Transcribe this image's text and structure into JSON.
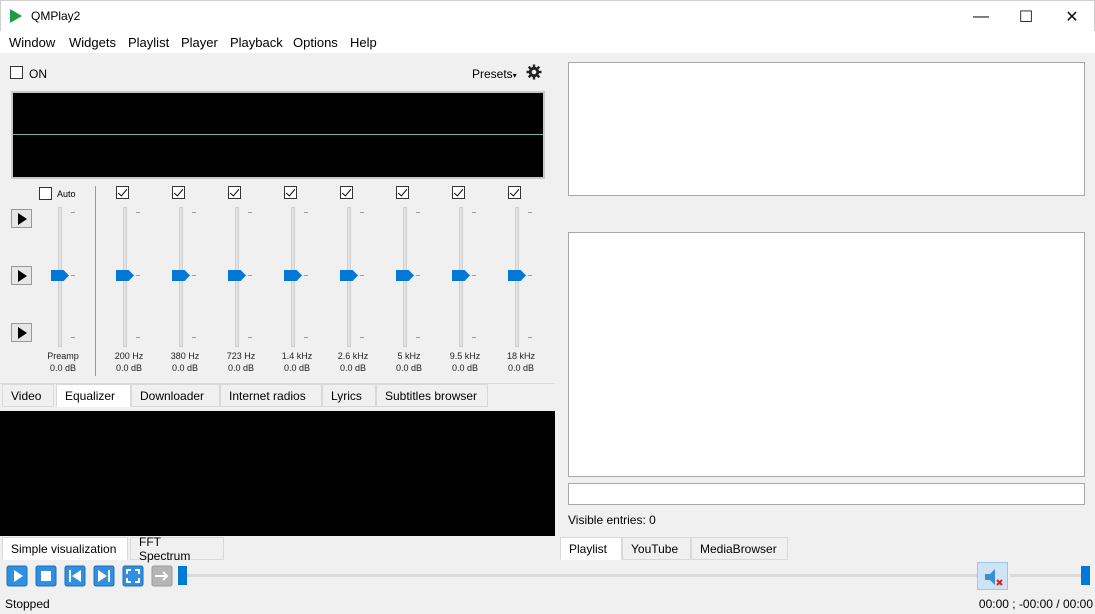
{
  "window": {
    "title": "QMPlay2",
    "minimize": "—",
    "maximize": "☐",
    "close": "✕"
  },
  "menu": [
    "Window",
    "Widgets",
    "Playlist",
    "Player",
    "Playback",
    "Options",
    "Help"
  ],
  "equalizer": {
    "on_label": "ON",
    "on_checked": false,
    "presets_label": "Presets",
    "auto_label": "Auto",
    "auto_checked": false,
    "bands": [
      {
        "label": "Preamp",
        "value": "0.0 dB",
        "checked": null
      },
      {
        "label": "200 Hz",
        "value": "0.0 dB",
        "checked": true
      },
      {
        "label": "380 Hz",
        "value": "0.0 dB",
        "checked": true
      },
      {
        "label": "723 Hz",
        "value": "0.0 dB",
        "checked": true
      },
      {
        "label": "1.4 kHz",
        "value": "0.0 dB",
        "checked": true
      },
      {
        "label": "2.6 kHz",
        "value": "0.0 dB",
        "checked": true
      },
      {
        "label": "5 kHz",
        "value": "0.0 dB",
        "checked": true
      },
      {
        "label": "9.5 kHz",
        "value": "0.0 dB",
        "checked": true
      },
      {
        "label": "18 kHz",
        "value": "0.0 dB",
        "checked": true
      }
    ]
  },
  "left_tabs": [
    {
      "label": "Video",
      "active": false
    },
    {
      "label": "Equalizer",
      "active": true
    },
    {
      "label": "Downloader",
      "active": false
    },
    {
      "label": "Internet radios",
      "active": false
    },
    {
      "label": "Lyrics",
      "active": false
    },
    {
      "label": "Subtitles browser",
      "active": false
    }
  ],
  "viz_tabs": [
    {
      "label": "Simple visualization",
      "active": true
    },
    {
      "label": "FFT Spectrum",
      "active": false
    }
  ],
  "playlist": {
    "search_value": "",
    "visible_entries": "Visible entries: 0"
  },
  "right_tabs": [
    {
      "label": "Playlist",
      "active": true
    },
    {
      "label": "YouTube",
      "active": false
    },
    {
      "label": "MediaBrowser",
      "active": false
    }
  ],
  "controls": {
    "seek_fraction": 0,
    "volume_fraction": 1,
    "muted": true
  },
  "status": {
    "state": "Stopped",
    "time": "00:00 ; -00:00 / 00:00"
  },
  "colors": {
    "accent": "#0078d7",
    "app_icon": "#1e9b4a",
    "graph_line": "#6fb3a9"
  }
}
